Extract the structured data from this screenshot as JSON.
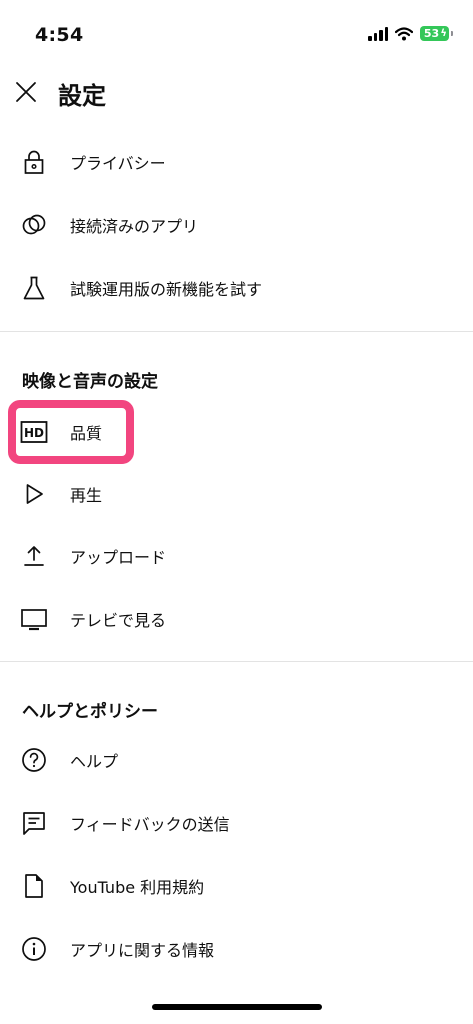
{
  "status_bar": {
    "time": "4:54",
    "battery_level": "53",
    "icons": [
      "signal-icon",
      "wifi-icon",
      "battery-icon"
    ]
  },
  "header": {
    "title": "設定",
    "close_icon": "close-icon"
  },
  "general_items": [
    {
      "label": "プライバシー",
      "icon": "lock-icon"
    },
    {
      "label": "接続済みのアプリ",
      "icon": "connected-apps-icon"
    },
    {
      "label": "試験運用版の新機能を試す",
      "icon": "flask-icon"
    }
  ],
  "video_audio_section": {
    "title": "映像と音声の設定",
    "items": [
      {
        "label": "品質",
        "icon": "hd-icon"
      },
      {
        "label": "再生",
        "icon": "play-icon"
      },
      {
        "label": "アップロード",
        "icon": "upload-icon"
      },
      {
        "label": "テレビで見る",
        "icon": "tv-icon"
      }
    ]
  },
  "help_section": {
    "title": "ヘルプとポリシー",
    "items": [
      {
        "label": "ヘルプ",
        "icon": "help-icon"
      },
      {
        "label": "フィードバックの送信",
        "icon": "feedback-icon"
      },
      {
        "label": "YouTube 利用規約",
        "icon": "document-icon"
      },
      {
        "label": "アプリに関する情報",
        "icon": "info-icon"
      }
    ]
  },
  "colors": {
    "highlight": "#f2457f",
    "battery": "#34c759",
    "divider": "#e3e3e3",
    "text": "#0f0f0f"
  }
}
